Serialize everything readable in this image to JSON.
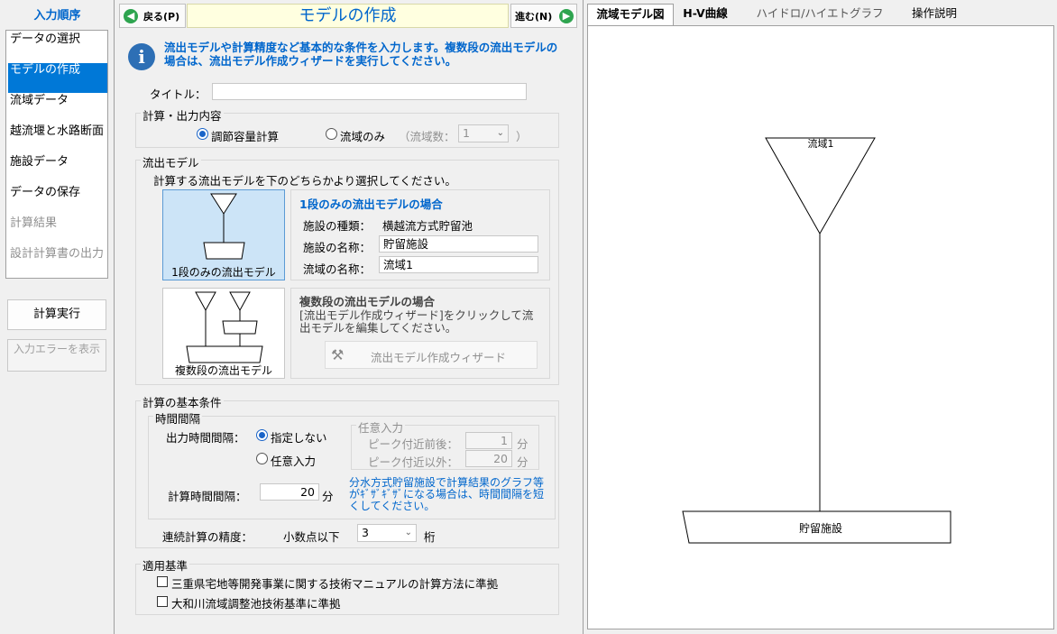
{
  "nav": {
    "title": "入力順序",
    "items": [
      {
        "label": "データの選択"
      },
      {
        "label": "モデルの作成"
      },
      {
        "label": "流域データ"
      },
      {
        "label": "越流堰と水路断面"
      },
      {
        "label": "施設データ"
      },
      {
        "label": "データの保存"
      },
      {
        "label": "計算結果"
      },
      {
        "label": "設計計算書の出力"
      }
    ],
    "run_button": "計算実行",
    "error_button": "入力エラーを表示"
  },
  "header": {
    "back_label": "戻る(P)",
    "title": "モデルの作成",
    "next_label": "進む(N)"
  },
  "info": {
    "text": "流出モデルや計算精度など基本的な条件を入力します。複数段の流出モデルの場合は、流出モデル作成ウィザードを実行してください。"
  },
  "title_field": {
    "label": "タイトル：",
    "value": ""
  },
  "calc_output": {
    "group_title": "計算・出力内容",
    "option_regulate": "調節容量計算",
    "option_basin_only": "流域のみ",
    "basin_count_label": "（流域数：",
    "basin_count_value": "1",
    "close_paren": "）"
  },
  "model": {
    "group_title": "流出モデル",
    "instruction": "計算する流出モデルを下のどちらかより選択してください。",
    "single_button": "1段のみの流出モデル",
    "multi_button": "複数段の流出モデル",
    "single": {
      "heading": "1段のみの流出モデルの場合",
      "facility_type_label": "施設の種類：",
      "facility_type_value": "横越流方式貯留池",
      "facility_name_label": "施設の名称：",
      "facility_name_value": "貯留施設",
      "basin_name_label": "流域の名称：",
      "basin_name_value": "流域1"
    },
    "multi": {
      "heading": "複数段の流出モデルの場合",
      "text": "[流出モデル作成ウィザード]をクリックして流出モデルを編集してください。",
      "wizard_button": "流出モデル作成ウィザード"
    }
  },
  "basic": {
    "group_title": "計算の基本条件",
    "interval_group_title": "時間間隔",
    "output_interval_label": "出力時間間隔：",
    "opt_unspecified": "指定しない",
    "opt_manual": "任意入力",
    "manual_group_title": "任意入力",
    "peak_near_label": "ピーク付近前後：",
    "peak_near_value": "1",
    "peak_other_label": "ピーク付近以外：",
    "peak_other_value": "20",
    "unit_min": "分",
    "calc_interval_label": "計算時間間隔：",
    "calc_interval_value": "20",
    "note": "分水方式貯留施設で計算結果のグラフ等がｷﾞｻﾞｷﾞｻﾞになる場合は、時間間隔を短くしてください。",
    "precision_label": "連続計算の精度：",
    "precision_prefix": "小数点以下",
    "precision_value": "3",
    "precision_unit": "桁"
  },
  "standards": {
    "group_title": "適用基準",
    "mie": "三重県宅地等開発事業に関する技術マニュアルの計算方法に準拠",
    "yamato": "大和川流域調整池技術基準に準拠"
  },
  "right": {
    "tabs": [
      {
        "label": "流域モデル図"
      },
      {
        "label": "H-V曲線"
      },
      {
        "label": "ハイドロ/ハイエトグラフ"
      },
      {
        "label": "操作説明"
      }
    ],
    "diagram": {
      "basin_label": "流域1",
      "facility_label": "貯留施設"
    }
  }
}
